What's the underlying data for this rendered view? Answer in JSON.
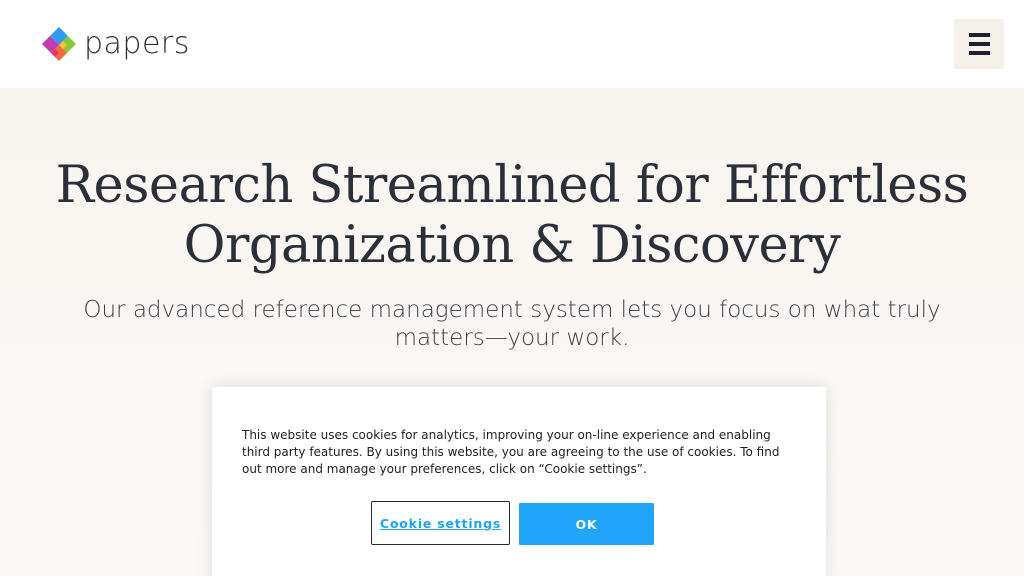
{
  "header": {
    "logo_text": "papers",
    "menu_icon": "hamburger-menu-icon"
  },
  "hero": {
    "title_line1": "Research Streamlined for Effortless",
    "title_line2": "Organization & Discovery",
    "subtitle": "Our advanced reference management system lets you focus on what truly matters—your work."
  },
  "cookie_banner": {
    "text": "This website uses cookies for analytics, improving your on-line experience and enabling third party features. By using this website, you are agreeing to the use of cookies. To find out more and manage your preferences, click on “Cookie settings”.",
    "settings_label": "Cookie settings",
    "ok_label": "OK"
  },
  "colors": {
    "accent_blue": "#20a5fb",
    "text_dark": "#2b2f3a",
    "hero_background": "#f8f4f0"
  }
}
